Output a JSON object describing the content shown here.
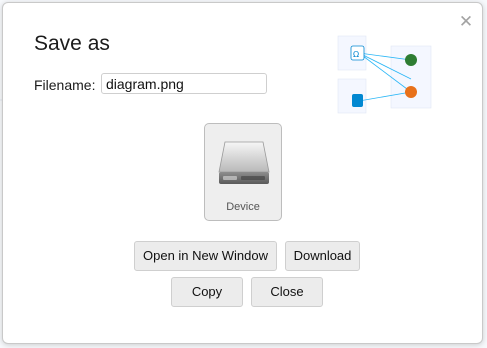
{
  "dialog": {
    "title": "Save as",
    "close_icon": "close-icon",
    "filename_label": "Filename:",
    "filename_value": "diagram.png",
    "device_label": "Device",
    "buttons": {
      "open_new_window": "Open in New Window",
      "download": "Download",
      "copy": "Copy",
      "close": "Close"
    }
  },
  "colors": {
    "green_node": "#2e7d32",
    "orange_node": "#e8711a",
    "blue_node": "#0288d1",
    "connector": "#29b6f6"
  }
}
